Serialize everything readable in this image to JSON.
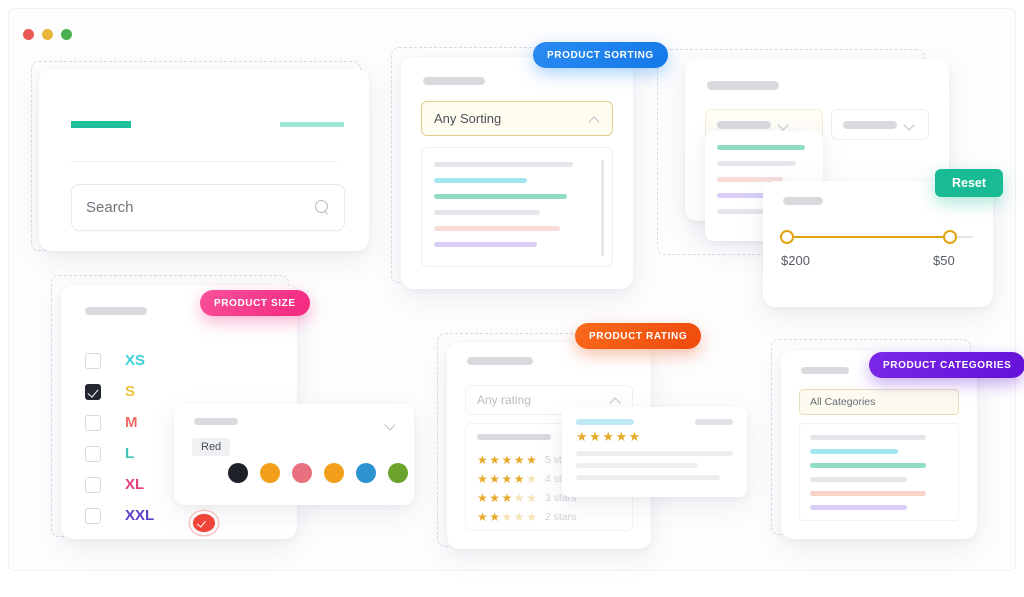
{
  "window": {
    "traffic_lights": [
      {
        "name": "close",
        "color": "#eb5a52"
      },
      {
        "name": "minimize",
        "color": "#e9b53c"
      },
      {
        "name": "maximize",
        "color": "#4cb050"
      }
    ]
  },
  "badges": {
    "sorting": {
      "label": "PRODUCT SORTING",
      "color": "#1478e8"
    },
    "size": {
      "label": "PRODUCT SIZE",
      "color": "#f4277f"
    },
    "rating": {
      "label": "PRODUCT RATING",
      "color": "#ef4a0c"
    },
    "categories": {
      "label": "PRODUCT CATEGORIES",
      "color": "#6411d8"
    }
  },
  "search_card": {
    "placeholder": "Search",
    "search_value": "Search",
    "accent_bar_color": "#1fbf9a",
    "secondary_bar_color": "#9ce6d4"
  },
  "sorting_card": {
    "select_value": "Any Sorting",
    "expanded": true,
    "border_color": "#e0cf8a",
    "options_bar_colors": [
      "#e4e6ea",
      "#9fe6f0",
      "#8fdcc4",
      "#e4e6ea",
      "#f7dcd9",
      "#d9cef5"
    ],
    "options_bar_widths": [
      "84%",
      "56%",
      "80%",
      "64%",
      "76%",
      "62%"
    ]
  },
  "filters_card": {
    "selects": [
      {
        "name": "first-filter",
        "highlighted": true
      },
      {
        "name": "second-filter",
        "highlighted": false
      }
    ]
  },
  "peek_card": {
    "bar_colors": [
      "#8fdcc4",
      "#e4e6ea",
      "#f7dcd9",
      "#d9cef5",
      "#e4e6ea"
    ],
    "bar_widths": [
      "94%",
      "84%",
      "70%",
      "70%",
      "64%"
    ]
  },
  "price_card": {
    "min_label": "$200",
    "max_label": "$50",
    "reset_label": "Reset",
    "slider_color": "#e0a410",
    "reset_color": "#18bb93"
  },
  "size_card": {
    "sizes": [
      {
        "label": "XS",
        "color": "#3fd0dd",
        "checked": false
      },
      {
        "label": "S",
        "color": "#e8c53d",
        "checked": true
      },
      {
        "label": "M",
        "color": "#ef6b62",
        "checked": false
      },
      {
        "label": "L",
        "color": "#3cc7b6",
        "checked": false
      },
      {
        "label": "XL",
        "color": "#e3407d",
        "checked": false
      },
      {
        "label": "XXL",
        "color": "#5b3fc4",
        "checked": false
      }
    ]
  },
  "color_card": {
    "tooltip": "Red",
    "swatches": [
      {
        "name": "red",
        "color": "#f04438",
        "selected": true
      },
      {
        "name": "black",
        "color": "#1e2228",
        "selected": false
      },
      {
        "name": "orange",
        "color": "#f2a01b",
        "selected": false
      },
      {
        "name": "pink",
        "color": "#e8707f",
        "selected": false
      },
      {
        "name": "amber",
        "color": "#f2a01b",
        "selected": false
      },
      {
        "name": "blue",
        "color": "#2d93d0",
        "selected": false
      },
      {
        "name": "green",
        "color": "#6ba32c",
        "selected": false
      }
    ]
  },
  "rating_card": {
    "select_value": "Any rating",
    "expanded": true,
    "rows": [
      {
        "label": "5 stars",
        "filled": 5
      },
      {
        "label": "4 stars",
        "filled": 4
      },
      {
        "label": "3 stars",
        "filled": 3
      },
      {
        "label": "2 stars",
        "filled": 2
      }
    ]
  },
  "review_card": {
    "stars": 5,
    "line_widths": [
      "100%",
      "78%",
      "92%"
    ]
  },
  "categories_card": {
    "select_value": "All Categories",
    "border_color": "#e6dfb9",
    "bar_colors": [
      "#e4e6ea",
      "#9fe6f0",
      "#8fdcc4",
      "#e4e6ea",
      "#f7d3cc",
      "#d9cef5"
    ],
    "bar_widths": [
      "84%",
      "64%",
      "84%",
      "70%",
      "84%",
      "70%"
    ]
  }
}
